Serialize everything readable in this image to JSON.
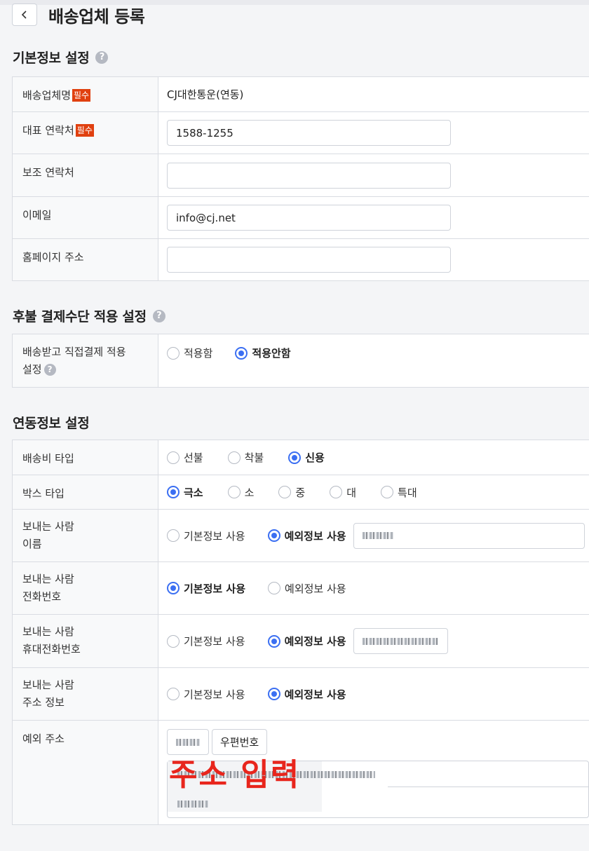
{
  "header": {
    "title": "배송업체 등록",
    "back_icon": "chevron-left-icon"
  },
  "basic": {
    "title": "기본정보 설정",
    "required_label": "필수",
    "rows": {
      "name_label": "배송업체명",
      "name_value": "CJ대한통운(연동)",
      "phone_label": "대표 연락처",
      "phone_value": "1588-1255",
      "sub_phone_label": "보조 연락처",
      "sub_phone_value": "",
      "email_label": "이메일",
      "email_value": "info@cj.net",
      "homepage_label": "홈페이지 주소",
      "homepage_value": ""
    }
  },
  "payment": {
    "title": "후불 결제수단 적용 설정",
    "label_line1": "배송받고 직접결제 적용",
    "label_line2": "설정",
    "options": [
      "적용함",
      "적용안함"
    ],
    "selected": "적용안함"
  },
  "link": {
    "title": "연동정보 설정",
    "fee_type": {
      "label": "배송비 타입",
      "options": [
        "선불",
        "착불",
        "신용"
      ],
      "selected": "신용"
    },
    "box_type": {
      "label": "박스 타입",
      "options": [
        "극소",
        "소",
        "중",
        "대",
        "특대"
      ],
      "selected": "극소"
    },
    "sender_name": {
      "label_line1": "보내는 사람",
      "label_line2": "이름",
      "opt_default": "기본정보 사용",
      "opt_custom": "예외정보 사용",
      "selected": "예외정보 사용"
    },
    "sender_phone": {
      "label_line1": "보내는 사람",
      "label_line2": "전화번호",
      "opt_default": "기본정보 사용",
      "opt_custom": "예외정보 사용",
      "selected": "기본정보 사용"
    },
    "sender_mobile": {
      "label_line1": "보내는 사람",
      "label_line2": "휴대전화번호",
      "opt_default": "기본정보 사용",
      "opt_custom": "예외정보 사용",
      "selected": "예외정보 사용"
    },
    "sender_address": {
      "label_line1": "보내는 사람",
      "label_line2": "주소 정보",
      "opt_default": "기본정보 사용",
      "opt_custom": "예외정보 사용",
      "selected": "예외정보 사용"
    },
    "exception_address": {
      "label": "예외 주소",
      "zip_button": "우편번호"
    }
  },
  "overlay_annotation": "주소 입력",
  "colors": {
    "accent": "#3b6ff2",
    "required": "#e0400f",
    "annotation": "#e8251c"
  }
}
